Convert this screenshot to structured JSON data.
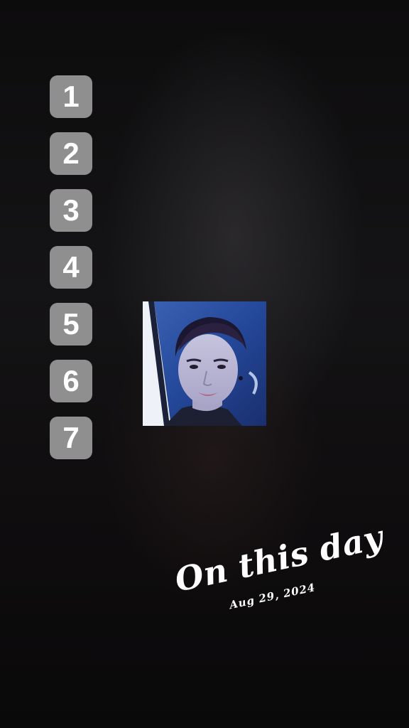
{
  "list": {
    "items": [
      "1",
      "2",
      "3",
      "4",
      "5",
      "6",
      "7"
    ]
  },
  "memory": {
    "title": "On this day",
    "date": "Aug 29, 2024"
  }
}
